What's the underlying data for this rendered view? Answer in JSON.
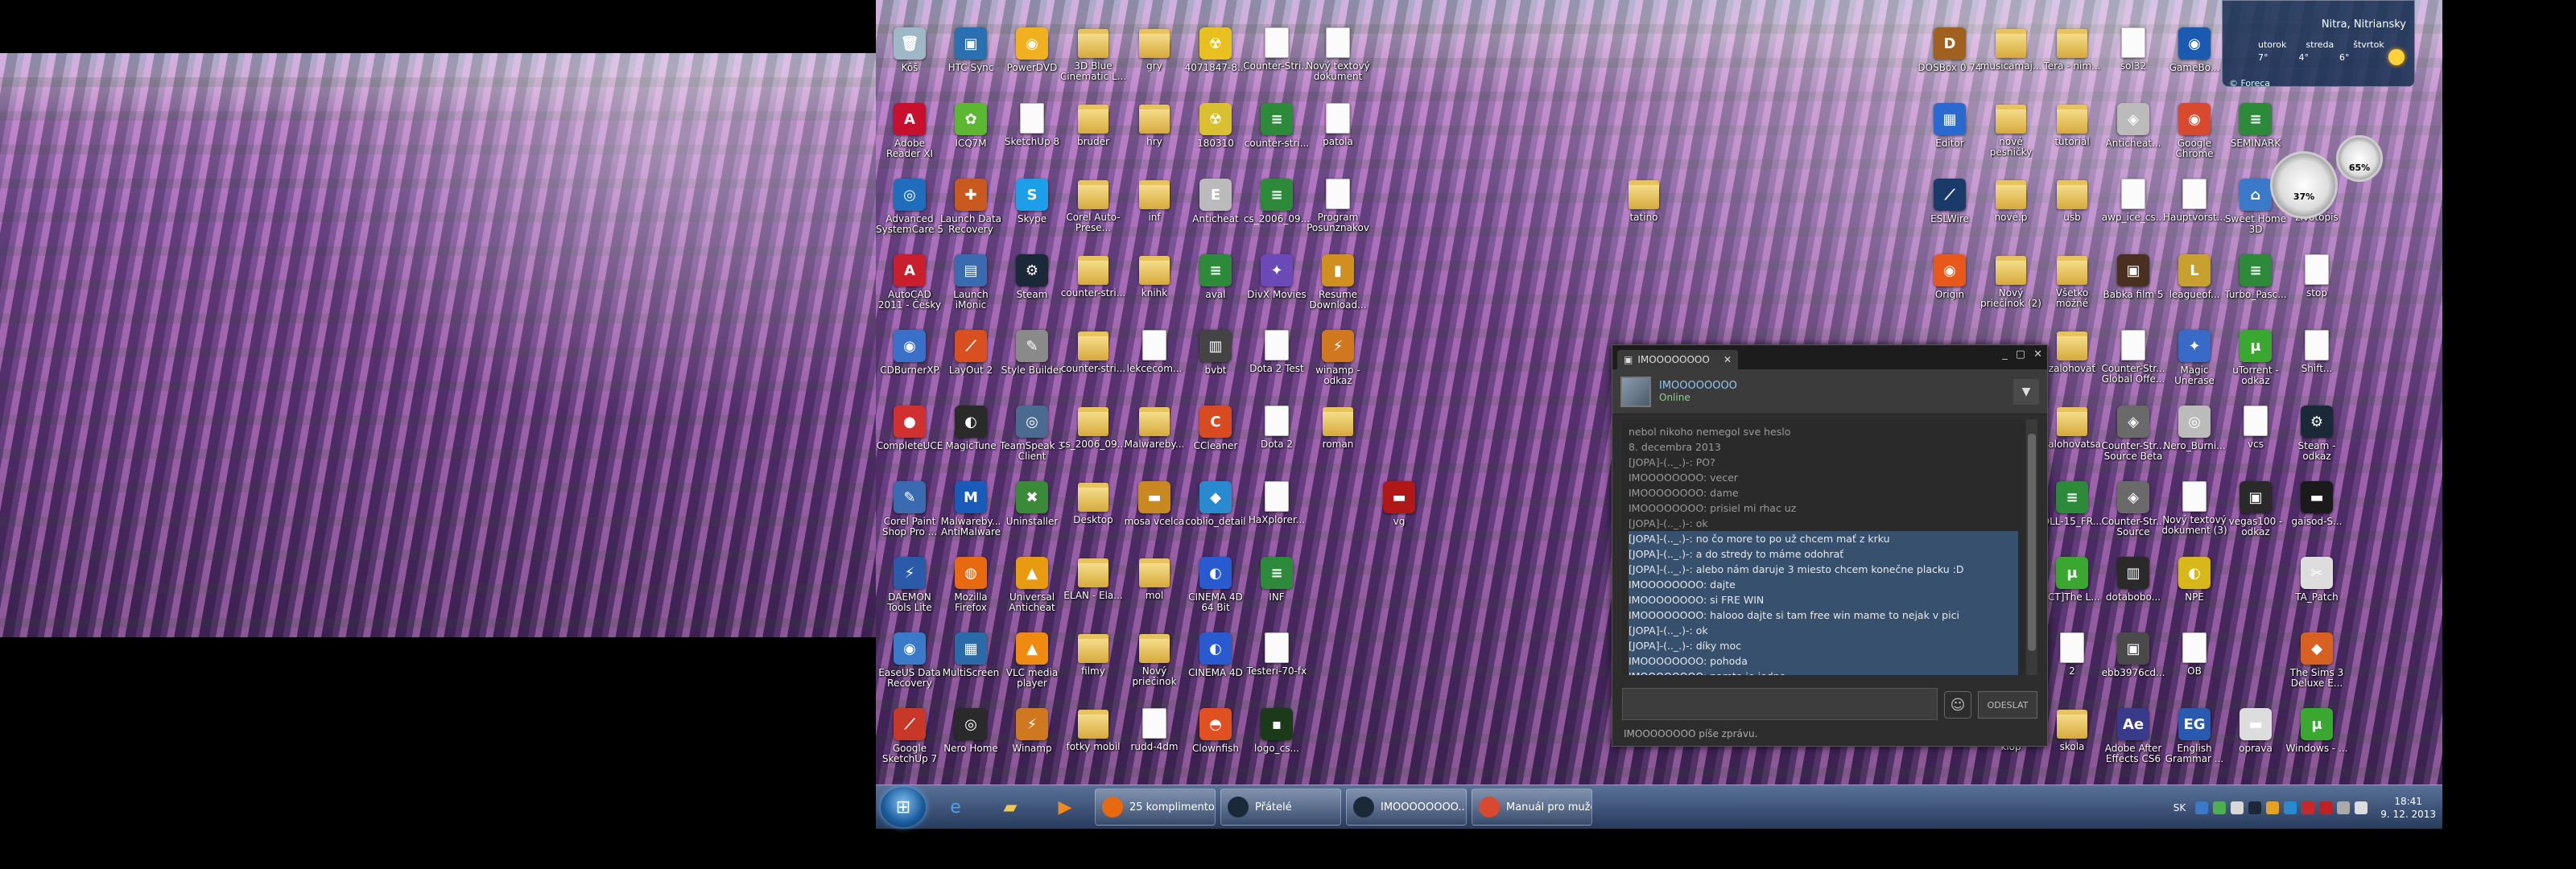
{
  "desktop": {
    "icons": [
      {
        "label": "Kôš",
        "color": "#9fb8c8",
        "glyph": "🗑",
        "col": 0,
        "row": 0
      },
      {
        "label": "HTC Sync",
        "color": "#2a6fb0",
        "glyph": "▣",
        "col": 1,
        "row": 0
      },
      {
        "label": "PowerDVD",
        "color": "#f0b020",
        "glyph": "◉",
        "col": 2,
        "row": 0
      },
      {
        "label": "3D Blue Cinematic L...",
        "kind": "folder",
        "col": 3,
        "row": 0
      },
      {
        "label": "gry",
        "kind": "folder",
        "col": 4,
        "row": 0
      },
      {
        "label": "4071847-8...",
        "color": "#e8c020",
        "glyph": "☢",
        "col": 5,
        "row": 0
      },
      {
        "label": "Counter-Stri...",
        "kind": "doc",
        "col": 6,
        "row": 0
      },
      {
        "label": "Nový textový dokument",
        "kind": "doc",
        "col": 7,
        "row": 0
      },
      {
        "label": "Adobe Reader XI",
        "color": "#c8102e",
        "glyph": "A",
        "col": 0,
        "row": 1
      },
      {
        "label": "ICQ7M",
        "color": "#5cb830",
        "glyph": "✿",
        "col": 1,
        "row": 1
      },
      {
        "label": "SketchUp 8",
        "kind": "doc",
        "col": 2,
        "row": 1
      },
      {
        "label": "bruder",
        "kind": "folder",
        "col": 3,
        "row": 1
      },
      {
        "label": "hry",
        "kind": "folder",
        "col": 4,
        "row": 1
      },
      {
        "label": "180310",
        "color": "#d8c030",
        "glyph": "☢",
        "col": 5,
        "row": 1
      },
      {
        "label": "counter-stri...",
        "color": "#2c8a3a",
        "glyph": "≡",
        "col": 6,
        "row": 1
      },
      {
        "label": "patola",
        "kind": "doc",
        "col": 7,
        "row": 1
      },
      {
        "label": "Advanced SystemCare 5",
        "color": "#1f6dbb",
        "glyph": "◎",
        "col": 0,
        "row": 2
      },
      {
        "label": "Launch Data Recovery",
        "color": "#c85a20",
        "glyph": "✚",
        "col": 1,
        "row": 2
      },
      {
        "label": "Skype",
        "color": "#1d9ee8",
        "glyph": "S",
        "col": 2,
        "row": 2
      },
      {
        "label": "Corel Auto-Prese...",
        "kind": "folder",
        "col": 3,
        "row": 2
      },
      {
        "label": "inf",
        "kind": "folder",
        "col": 4,
        "row": 2
      },
      {
        "label": "Anticheat",
        "color": "#bbbbbb",
        "glyph": "E",
        "col": 5,
        "row": 2
      },
      {
        "label": "cs_2006_09...",
        "color": "#2c8a3a",
        "glyph": "≡",
        "col": 6,
        "row": 2
      },
      {
        "label": "Program Posunznakov",
        "kind": "doc",
        "col": 7,
        "row": 2
      },
      {
        "label": "AutoCAD 2011 - Česky",
        "color": "#c81e2e",
        "glyph": "A",
        "col": 0,
        "row": 3
      },
      {
        "label": "Launch iMonic",
        "color": "#3a6ab0",
        "glyph": "▤",
        "col": 1,
        "row": 3
      },
      {
        "label": "Steam",
        "color": "#1b2838",
        "glyph": "⚙",
        "col": 2,
        "row": 3
      },
      {
        "label": "counter-stri...",
        "kind": "folder",
        "col": 3,
        "row": 3
      },
      {
        "label": "knihk",
        "kind": "folder",
        "col": 4,
        "row": 3
      },
      {
        "label": "aval",
        "color": "#2c8a3a",
        "glyph": "≡",
        "col": 5,
        "row": 3
      },
      {
        "label": "DivX Movies",
        "color": "#6b4ab8",
        "glyph": "✦",
        "col": 6,
        "row": 3
      },
      {
        "label": "Resume Download...",
        "color": "#d09020",
        "glyph": "▮",
        "col": 7,
        "row": 3
      },
      {
        "label": "CDBurnerXP",
        "color": "#3a70c8",
        "glyph": "◉",
        "col": 0,
        "row": 4
      },
      {
        "label": "LayOut 2",
        "color": "#d85020",
        "glyph": "⟋",
        "col": 1,
        "row": 4
      },
      {
        "label": "Style Builder",
        "color": "#8a8a8a",
        "glyph": "✎",
        "col": 2,
        "row": 4
      },
      {
        "label": "counter-stri...",
        "kind": "folder",
        "col": 3,
        "row": 4
      },
      {
        "label": "lekcecom...",
        "kind": "doc",
        "col": 4,
        "row": 4
      },
      {
        "label": "bvbt",
        "color": "#444444",
        "glyph": "▥",
        "col": 5,
        "row": 4
      },
      {
        "label": "Dota 2 Test",
        "kind": "doc",
        "col": 6,
        "row": 4
      },
      {
        "label": "winamp - odkaz",
        "color": "#d07820",
        "glyph": "⚡",
        "col": 7,
        "row": 4
      },
      {
        "label": "CompleteUCE",
        "color": "#d03030",
        "glyph": "●",
        "col": 0,
        "row": 5
      },
      {
        "label": "MagicTune",
        "color": "#2a2a2a",
        "glyph": "◐",
        "col": 1,
        "row": 5
      },
      {
        "label": "TeamSpeak 3 Client",
        "color": "#4a6a90",
        "glyph": "◎",
        "col": 2,
        "row": 5
      },
      {
        "label": "cs_2006_09...",
        "kind": "folder",
        "col": 3,
        "row": 5
      },
      {
        "label": "Malwareby...",
        "kind": "folder",
        "col": 4,
        "row": 5
      },
      {
        "label": "CCleaner",
        "color": "#d84a20",
        "glyph": "C",
        "col": 5,
        "row": 5
      },
      {
        "label": "Dota 2",
        "kind": "doc",
        "col": 6,
        "row": 5
      },
      {
        "label": "roman",
        "kind": "folder",
        "col": 7,
        "row": 5
      },
      {
        "label": "Corel Paint Shop Pro ...",
        "color": "#3a6ab0",
        "glyph": "✎",
        "col": 0,
        "row": 6
      },
      {
        "label": "Malwareby... AntiMalware",
        "color": "#1a5ab8",
        "glyph": "M",
        "col": 1,
        "row": 6
      },
      {
        "label": "Uninstaller",
        "color": "#3a8a3a",
        "glyph": "✖",
        "col": 2,
        "row": 6
      },
      {
        "label": "Desktop",
        "kind": "folder",
        "col": 3,
        "row": 6
      },
      {
        "label": "mosa vcelca",
        "color": "#c88a20",
        "glyph": "▬",
        "col": 4,
        "row": 6
      },
      {
        "label": "coblio_detail",
        "color": "#2a8ad0",
        "glyph": "◆",
        "col": 5,
        "row": 6
      },
      {
        "label": "HaXplorer...",
        "kind": "doc",
        "col": 6,
        "row": 6
      },
      {
        "label": "vg",
        "color": "#b01818",
        "glyph": "▬",
        "col": 8,
        "row": 6
      },
      {
        "label": "DAEMON Tools Lite",
        "color": "#2a5aa8",
        "glyph": "⚡",
        "col": 0,
        "row": 7
      },
      {
        "label": "Mozilla Firefox",
        "color": "#e86a10",
        "glyph": "◍",
        "col": 1,
        "row": 7
      },
      {
        "label": "Universal Anticheat",
        "color": "#e89a10",
        "glyph": "▲",
        "col": 2,
        "row": 7
      },
      {
        "label": "ELAN - Ela...",
        "kind": "folder",
        "col": 3,
        "row": 7
      },
      {
        "label": "mol",
        "kind": "folder",
        "col": 4,
        "row": 7
      },
      {
        "label": "CINEMA 4D 64 Bit",
        "color": "#2a5ad0",
        "glyph": "◐",
        "col": 5,
        "row": 7
      },
      {
        "label": "INF",
        "color": "#2c8a3a",
        "glyph": "≡",
        "col": 6,
        "row": 7
      },
      {
        "label": "EaseUS Data Recovery",
        "color": "#3a7ac8",
        "glyph": "◉",
        "col": 0,
        "row": 8
      },
      {
        "label": "MultiScreen",
        "color": "#2a6aa8",
        "glyph": "▦",
        "col": 1,
        "row": 8
      },
      {
        "label": "VLC media player",
        "color": "#f08a10",
        "glyph": "▲",
        "col": 2,
        "row": 8
      },
      {
        "label": "filmy",
        "kind": "folder",
        "col": 3,
        "row": 8
      },
      {
        "label": "Nový priečinok",
        "kind": "folder",
        "col": 4,
        "row": 8
      },
      {
        "label": "CINEMA 4D",
        "color": "#2a5ad0",
        "glyph": "◐",
        "col": 5,
        "row": 8
      },
      {
        "label": "Testeri-70-fx",
        "kind": "doc",
        "col": 6,
        "row": 8
      },
      {
        "label": "Google SketchUp 7",
        "color": "#c83828",
        "glyph": "⟋",
        "col": 0,
        "row": 9
      },
      {
        "label": "Nero Home",
        "color": "#2a2a2a",
        "glyph": "◎",
        "col": 1,
        "row": 9
      },
      {
        "label": "Winamp",
        "color": "#d07820",
        "glyph": "⚡",
        "col": 2,
        "row": 9
      },
      {
        "label": "fotky mobil",
        "kind": "folder",
        "col": 3,
        "row": 9
      },
      {
        "label": "rudd-4dm",
        "kind": "doc",
        "col": 4,
        "row": 9
      },
      {
        "label": "Clownfish",
        "color": "#e05020",
        "glyph": "◓",
        "col": 5,
        "row": 9
      },
      {
        "label": "logo_cs...",
        "color": "#1a3a1a",
        "glyph": "▪",
        "col": 6,
        "row": 9
      },
      {
        "label": "tatino",
        "kind": "folder",
        "col": 12,
        "row": 2
      },
      {
        "label": "DOSBox 0.74",
        "color": "#a06020",
        "glyph": "D",
        "col": 17,
        "row": 0
      },
      {
        "label": "musicamaj...",
        "kind": "folder",
        "col": 18,
        "row": 0
      },
      {
        "label": "Tera - nim...",
        "kind": "folder",
        "col": 19,
        "row": 0
      },
      {
        "label": "sol32",
        "kind": "doc",
        "col": 20,
        "row": 0
      },
      {
        "label": "GameBo...",
        "color": "#1a5ab0",
        "glyph": "◉",
        "col": 21,
        "row": 0
      },
      {
        "label": "Editor",
        "color": "#2a6ad0",
        "glyph": "▦",
        "col": 17,
        "row": 1
      },
      {
        "label": "nové pesničky",
        "kind": "folder",
        "col": 18,
        "row": 1
      },
      {
        "label": "tutorial",
        "kind": "folder",
        "col": 19,
        "row": 1
      },
      {
        "label": "Anticheat...",
        "color": "#bbbbbb",
        "glyph": "◈",
        "col": 20,
        "row": 1
      },
      {
        "label": "Google Chrome",
        "color": "#d84a30",
        "glyph": "◉",
        "col": 21,
        "row": 1
      },
      {
        "label": "SEMINARK",
        "color": "#2c8a3a",
        "glyph": "≡",
        "col": 22,
        "row": 1
      },
      {
        "label": "ESLWire",
        "color": "#1a3a6a",
        "glyph": "⟋",
        "col": 17,
        "row": 2
      },
      {
        "label": "nové.p",
        "kind": "folder",
        "col": 18,
        "row": 2
      },
      {
        "label": "usb",
        "kind": "folder",
        "col": 19,
        "row": 2
      },
      {
        "label": "awp_ice_cs...",
        "kind": "doc",
        "col": 20,
        "row": 2
      },
      {
        "label": "Hauptvorst...",
        "kind": "doc",
        "col": 21,
        "row": 2
      },
      {
        "label": "Sweet Home 3D",
        "color": "#3a7ac8",
        "glyph": "⌂",
        "col": 22,
        "row": 2
      },
      {
        "label": "zivotopis",
        "kind": "doc",
        "col": 23,
        "row": 2
      },
      {
        "label": "Origin",
        "color": "#e8581a",
        "glyph": "◉",
        "col": 17,
        "row": 3
      },
      {
        "label": "Nový priečinok (2)",
        "kind": "folder",
        "col": 18,
        "row": 3
      },
      {
        "label": "Všetko možné",
        "kind": "folder",
        "col": 19,
        "row": 3
      },
      {
        "label": "Babka film 5",
        "color": "#4a3020",
        "glyph": "▣",
        "col": 20,
        "row": 3
      },
      {
        "label": "leagueof...",
        "color": "#c8a030",
        "glyph": "L",
        "col": 21,
        "row": 3
      },
      {
        "label": "Turbo_Pasc...",
        "color": "#2c8a3a",
        "glyph": "≡",
        "col": 22,
        "row": 3
      },
      {
        "label": "stop",
        "kind": "doc",
        "col": 23,
        "row": 3
      },
      {
        "label": "zalohovať",
        "kind": "folder",
        "col": 19,
        "row": 4
      },
      {
        "label": "Counter-Str... Global Offe...",
        "kind": "doc",
        "col": 20,
        "row": 4
      },
      {
        "label": "Magic Unerase",
        "color": "#3a6ac8",
        "glyph": "✦",
        "col": 21,
        "row": 4
      },
      {
        "label": "uTorrent - odkaz",
        "color": "#3aa830",
        "glyph": "μ",
        "col": 22,
        "row": 4
      },
      {
        "label": "Shift...",
        "kind": "doc",
        "col": 23,
        "row": 4
      },
      {
        "label": "zalohovatsa",
        "kind": "folder",
        "col": 19,
        "row": 5
      },
      {
        "label": "Counter-Str... Source Beta",
        "color": "#6a6a6a",
        "glyph": "◈",
        "col": 20,
        "row": 5
      },
      {
        "label": "Nero_Burni...",
        "color": "#bbbbbb",
        "glyph": "◎",
        "col": 21,
        "row": 5
      },
      {
        "label": "vcs",
        "kind": "doc",
        "col": 22,
        "row": 5
      },
      {
        "label": "Steam - odkaz",
        "color": "#1b2838",
        "glyph": "⚙",
        "col": 23,
        "row": 5
      },
      {
        "label": "DLL-15_FR...",
        "color": "#2c8a3a",
        "glyph": "≡",
        "col": 19,
        "row": 6
      },
      {
        "label": "Counter-Str... Source",
        "color": "#6a6a6a",
        "glyph": "◈",
        "col": 20,
        "row": 6
      },
      {
        "label": "Nový textový dokument (3)",
        "kind": "doc",
        "col": 21,
        "row": 6
      },
      {
        "label": "vegas100 - odkaz",
        "color": "#2a2a2a",
        "glyph": "▣",
        "col": 22,
        "row": 6
      },
      {
        "label": "gaisod-S...",
        "color": "#1a1a1a",
        "glyph": "▬",
        "col": 23,
        "row": 6
      },
      {
        "label": "[CT]The L...",
        "color": "#3aa830",
        "glyph": "μ",
        "col": 19,
        "row": 7
      },
      {
        "label": "dotabobo...",
        "color": "#2a2a2a",
        "glyph": "▥",
        "col": 20,
        "row": 7
      },
      {
        "label": "NPE",
        "color": "#d8b818",
        "glyph": "◐",
        "col": 21,
        "row": 7
      },
      {
        "label": "TA_Patch",
        "color": "#dddddd",
        "glyph": "✂",
        "col": 23,
        "row": 7
      },
      {
        "label": "2",
        "kind": "doc",
        "col": 19,
        "row": 8
      },
      {
        "label": "ebb3976cd...",
        "color": "#4a4a4a",
        "glyph": "▣",
        "col": 20,
        "row": 8
      },
      {
        "label": "OB",
        "kind": "doc",
        "col": 21,
        "row": 8
      },
      {
        "label": "The Sims 3 Deluxe E...",
        "color": "#d86020",
        "glyph": "◆",
        "col": 23,
        "row": 8
      },
      {
        "label": "klop",
        "kind": "folder",
        "col": 18,
        "row": 9
      },
      {
        "label": "skola",
        "kind": "folder",
        "col": 19,
        "row": 9
      },
      {
        "label": "Adobe After Effects CS6",
        "color": "#3a3a8a",
        "glyph": "Ae",
        "col": 20,
        "row": 9
      },
      {
        "label": "English Grammar ...",
        "color": "#2a5ab0",
        "glyph": "EG",
        "col": 21,
        "row": 9
      },
      {
        "label": "oprava",
        "color": "#dddddd",
        "glyph": "▬",
        "col": 22,
        "row": 9
      },
      {
        "label": "Windows - ...",
        "color": "#3aa830",
        "glyph": "μ",
        "col": 23,
        "row": 9
      }
    ]
  },
  "chat": {
    "tab_title": "IMOOOOOOOO",
    "contact_name": "IMOOOOOOOO",
    "contact_status": "Online",
    "messages": [
      {
        "text": "nebol nikoho nemegol sve heslo",
        "style": "o"
      },
      {
        "text": "8. decembra 2013",
        "style": "o"
      },
      {
        "text": "[JOPA]-(.._.)-: PO?",
        "style": "o"
      },
      {
        "text": "IMOOOOOOOO: vecer",
        "style": "o"
      },
      {
        "text": "IMOOOOOOOO: dame",
        "style": "o"
      },
      {
        "text": "IMOOOOOOOO: prisiel mi rhac uz",
        "style": "o"
      },
      {
        "text": "[JOPA]-(.._.)-: ok",
        "style": "o"
      },
      {
        "text": "[JOPA]-(.._.)-: no čo more to po už chcem mať z krku",
        "style": "s"
      },
      {
        "text": "[JOPA]-(.._.)-: a do stredy to máme odohrať",
        "style": "s"
      },
      {
        "text": "[JOPA]-(.._.)-: alebo nám daruje 3 miesto chcem konečne placku :D",
        "style": "s"
      },
      {
        "text": "IMOOOOOOOO: dajte",
        "style": "s"
      },
      {
        "text": "IMOOOOOOOO: si FRE WIN",
        "style": "s"
      },
      {
        "text": "IMOOOOOOOO: halooo dajte si tam free  win mame to nejak v pici",
        "style": "s"
      },
      {
        "text": "[JOPA]-(.._.)-: ok",
        "style": "s"
      },
      {
        "text": "[JOPA]-(.._.)-: díky moc",
        "style": "s"
      },
      {
        "text": "IMOOOOOOOO: pohoda",
        "style": "s"
      },
      {
        "text": "IMOOOOOOOO: namto je jedno",
        "style": "s"
      }
    ],
    "input_value": "",
    "send_label": "ODESLAT",
    "typing_text": "IMOOOOOOOO píše zprávu."
  },
  "weather": {
    "location": "Nitra, Nitriansky",
    "days": [
      "utorok",
      "streda",
      "štvrtok"
    ],
    "temps": [
      "7°",
      "4°",
      "6°"
    ],
    "source": "© Foreca"
  },
  "gauge": {
    "cpu": "37%",
    "ram": "65%"
  },
  "taskbar": {
    "tasks": [
      {
        "label": "25 komplimentov...",
        "color": "#e86a10"
      },
      {
        "label": "Přátelé",
        "color": "#1b2838"
      },
      {
        "label": "IMOOOOOOOO...",
        "color": "#1b2838"
      },
      {
        "label": "Manuál pro muže...",
        "color": "#d84a30"
      }
    ],
    "lang": "SK",
    "time": "18:41",
    "date": "9. 12. 2013"
  },
  "colors": {
    "accent": "#37506e",
    "taskbar": "#2c4570"
  }
}
